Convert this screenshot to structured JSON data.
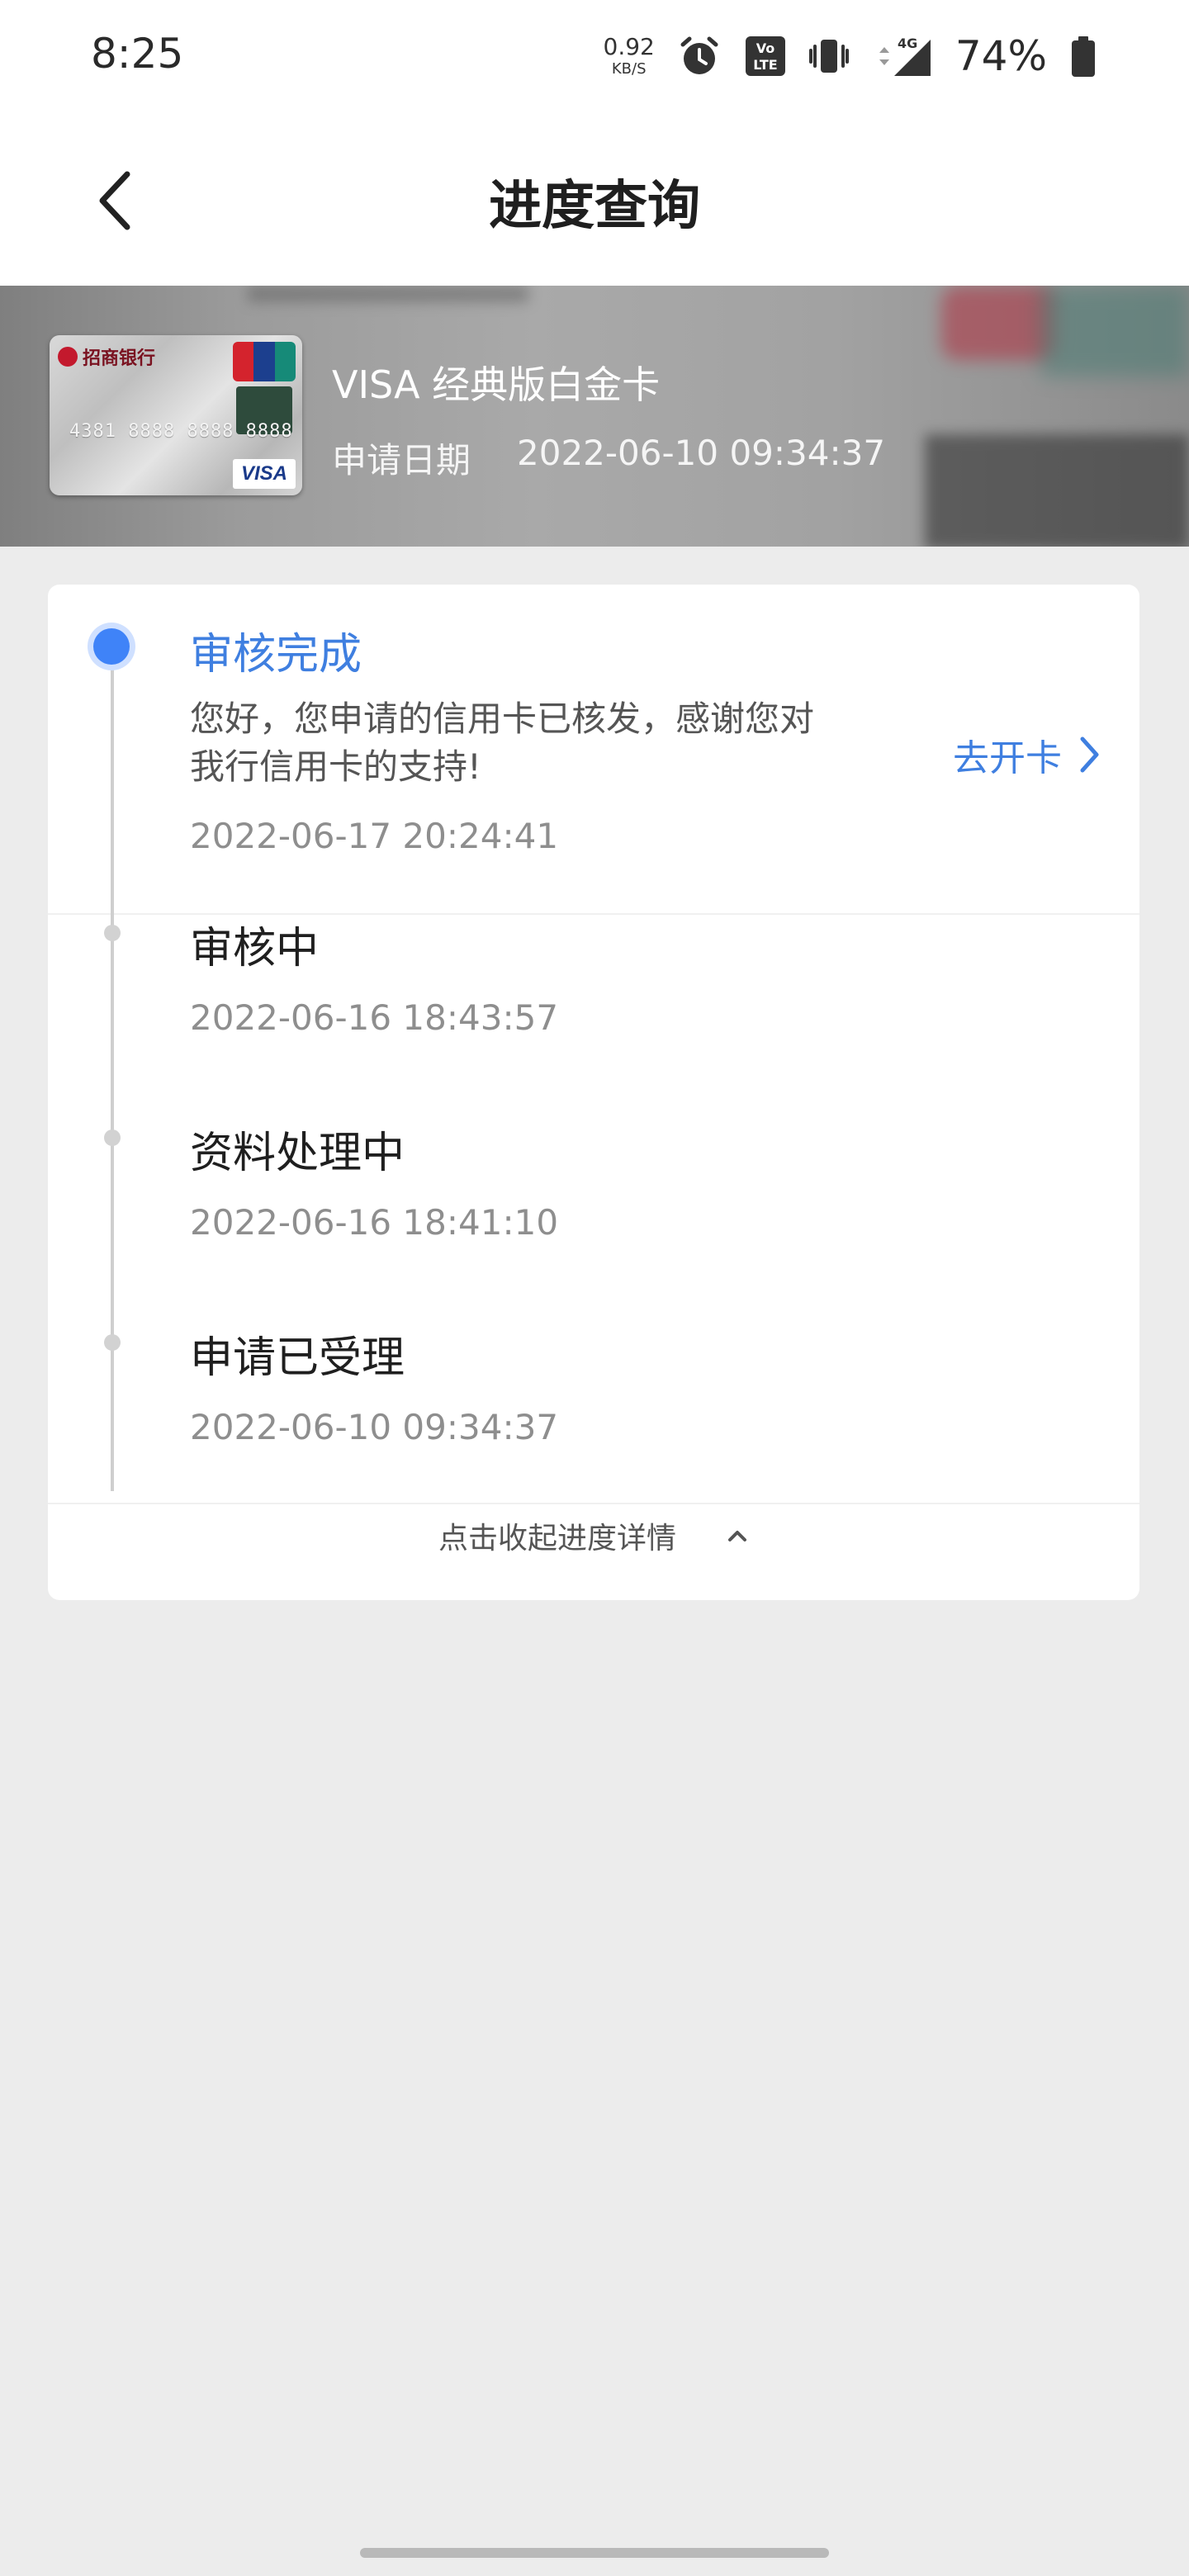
{
  "status_bar": {
    "time": "8:25",
    "net_speed_value": "0.92",
    "net_speed_unit": "KB/S",
    "network_type": "4G",
    "volte_label": "VoLTE",
    "battery_percent": "74%",
    "icons": [
      "alarm-icon",
      "volte-icon",
      "vibrate-icon",
      "signal-icon",
      "battery-icon"
    ]
  },
  "nav": {
    "title": "进度查询",
    "back_icon": "chevron-left-icon"
  },
  "card": {
    "image_bank_name": "招商银行",
    "image_card_number": "4381 8888 8888 8888",
    "image_network_label": "VISA",
    "image_unionpay_label": "UnionPay 银联",
    "name": "VISA 经典版白金卡",
    "apply_date_label": "申请日期",
    "apply_date_value": "2022-06-10 09:34:37"
  },
  "progress": {
    "steps": [
      {
        "title": "审核完成",
        "desc": "您好，您申请的信用卡已核发，感谢您对我行信用卡的支持!",
        "time": "2022-06-17 20:24:41",
        "active": true
      },
      {
        "title": "审核中",
        "time": "2022-06-16 18:43:57",
        "active": false
      },
      {
        "title": "资料处理中",
        "time": "2022-06-16 18:41:10",
        "active": false
      },
      {
        "title": "申请已受理",
        "time": "2022-06-10 09:34:37",
        "active": false
      }
    ],
    "action_label": "去开卡",
    "collapse_label": "点击收起进度详情"
  },
  "colors": {
    "accent": "#3f7fe0",
    "dot_active": "#3f83f8",
    "page_bg": "#ececec"
  }
}
